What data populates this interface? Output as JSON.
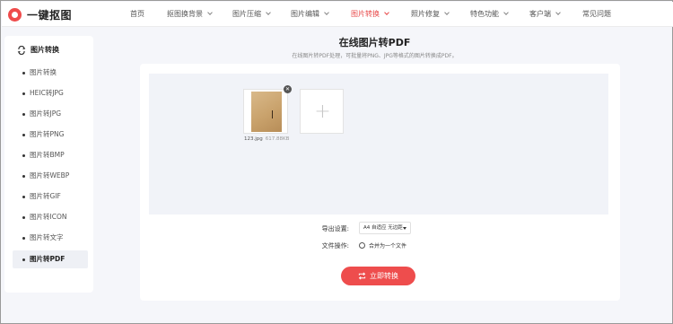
{
  "app": {
    "logo_text": "一键抠图"
  },
  "nav": [
    {
      "label": "首页",
      "has_menu": false
    },
    {
      "label": "抠图换背景",
      "has_menu": true
    },
    {
      "label": "图片压缩",
      "has_menu": true
    },
    {
      "label": "图片编辑",
      "has_menu": true
    },
    {
      "label": "图片转换",
      "has_menu": true,
      "active": true
    },
    {
      "label": "照片修复",
      "has_menu": true
    },
    {
      "label": "特色功能",
      "has_menu": true
    },
    {
      "label": "客户端",
      "has_menu": true
    },
    {
      "label": "常见问题",
      "has_menu": false
    }
  ],
  "sidebar": {
    "heading": "图片转换",
    "items": [
      {
        "label": "图片转换"
      },
      {
        "label": "HEIC转JPG"
      },
      {
        "label": "图片转JPG"
      },
      {
        "label": "图片转PNG"
      },
      {
        "label": "图片转BMP"
      },
      {
        "label": "图片转WEBP"
      },
      {
        "label": "图片转GIF"
      },
      {
        "label": "图片转ICON"
      },
      {
        "label": "图片转文字"
      },
      {
        "label": "图片转PDF",
        "active": true
      }
    ]
  },
  "main": {
    "title": "在线图片转PDF",
    "subtitle": "在线图片转PDF处理，可批量将PNG、JPG等格式的图片转换成PDF。",
    "file": {
      "name": "123.jpg",
      "size": "617.88KB"
    },
    "add_symbol": "+",
    "export_label": "导出设置:",
    "export_value": "A4 自适应 无边距",
    "file_op_label": "文件操作:",
    "merge_option": "合并为一个文件",
    "convert_button": "立即转换"
  },
  "colors": {
    "accent": "#ee4d4d",
    "nav_active": "#e84a4a"
  }
}
